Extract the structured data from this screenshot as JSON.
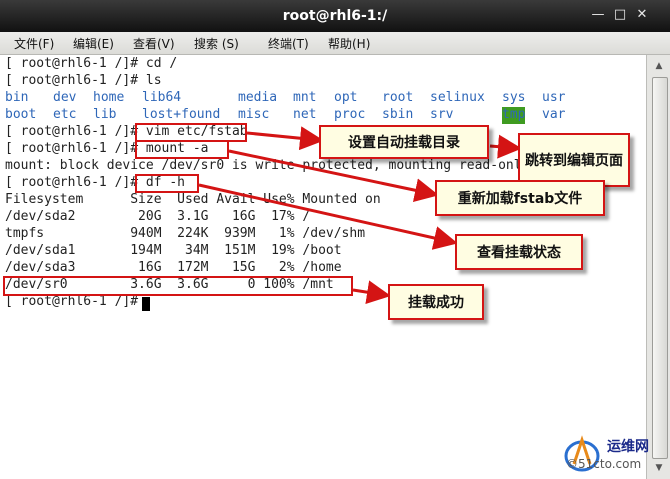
{
  "window": {
    "title": "root@rhl6-1:/",
    "min_symbol": "—",
    "max_symbol": "□",
    "close_symbol": "✕"
  },
  "menu": [
    "文件(F)",
    "编辑(E)",
    "查看(V)",
    "搜索 (S)",
    "终端(T)",
    "帮助(H)"
  ],
  "terminal": {
    "lines": [
      "[ root@rhl6-1 /]# cd /",
      "[ root@rhl6-1 /]# ls",
      "",
      "",
      "[ root@rhl6-1 /]# vim etc/fstab",
      "[ root@rhl6-1 /]# mount -a",
      "mount: block device /dev/sr0 is write-protected, mounting read-only",
      "[ root@rhl6-1 /]# df -h",
      "Filesystem      Size  Used Avail Use% Mounted on",
      "/dev/sda2        20G  3.1G   16G  17% /",
      "tmpfs           940M  224K  939M   1% /dev/shm",
      "/dev/sda1       194M   34M  151M  19% /boot",
      "/dev/sda3        16G  172M   15G   2% /home",
      "/dev/sr0        3.6G  3.6G     0 100% /mnt",
      "[ root@rhl6-1 /]# "
    ],
    "ls_row1": [
      "bin",
      "dev",
      "home",
      "lib64",
      "media",
      "mnt",
      "opt",
      "root",
      "selinux",
      "sys",
      "usr"
    ],
    "ls_row2": [
      "boot",
      "etc",
      "lib",
      "lost+found",
      "misc",
      "net",
      "proc",
      "sbin",
      "srv",
      "tmp",
      "var"
    ],
    "dir_color": "#2f67b8",
    "tmp_highlight": "#3f9b21"
  },
  "annotations": {
    "set_mount_dir": "设置自动挂载目录",
    "jump_to_edit": "跳转到编辑页面",
    "reload_fstab": "重新加载fstab文件",
    "check_mount": "查看挂载状态",
    "mount_success": "挂载成功",
    "accent": "#d41414"
  },
  "watermark": {
    "brand": "运维网",
    "site": "©51cto.com"
  }
}
